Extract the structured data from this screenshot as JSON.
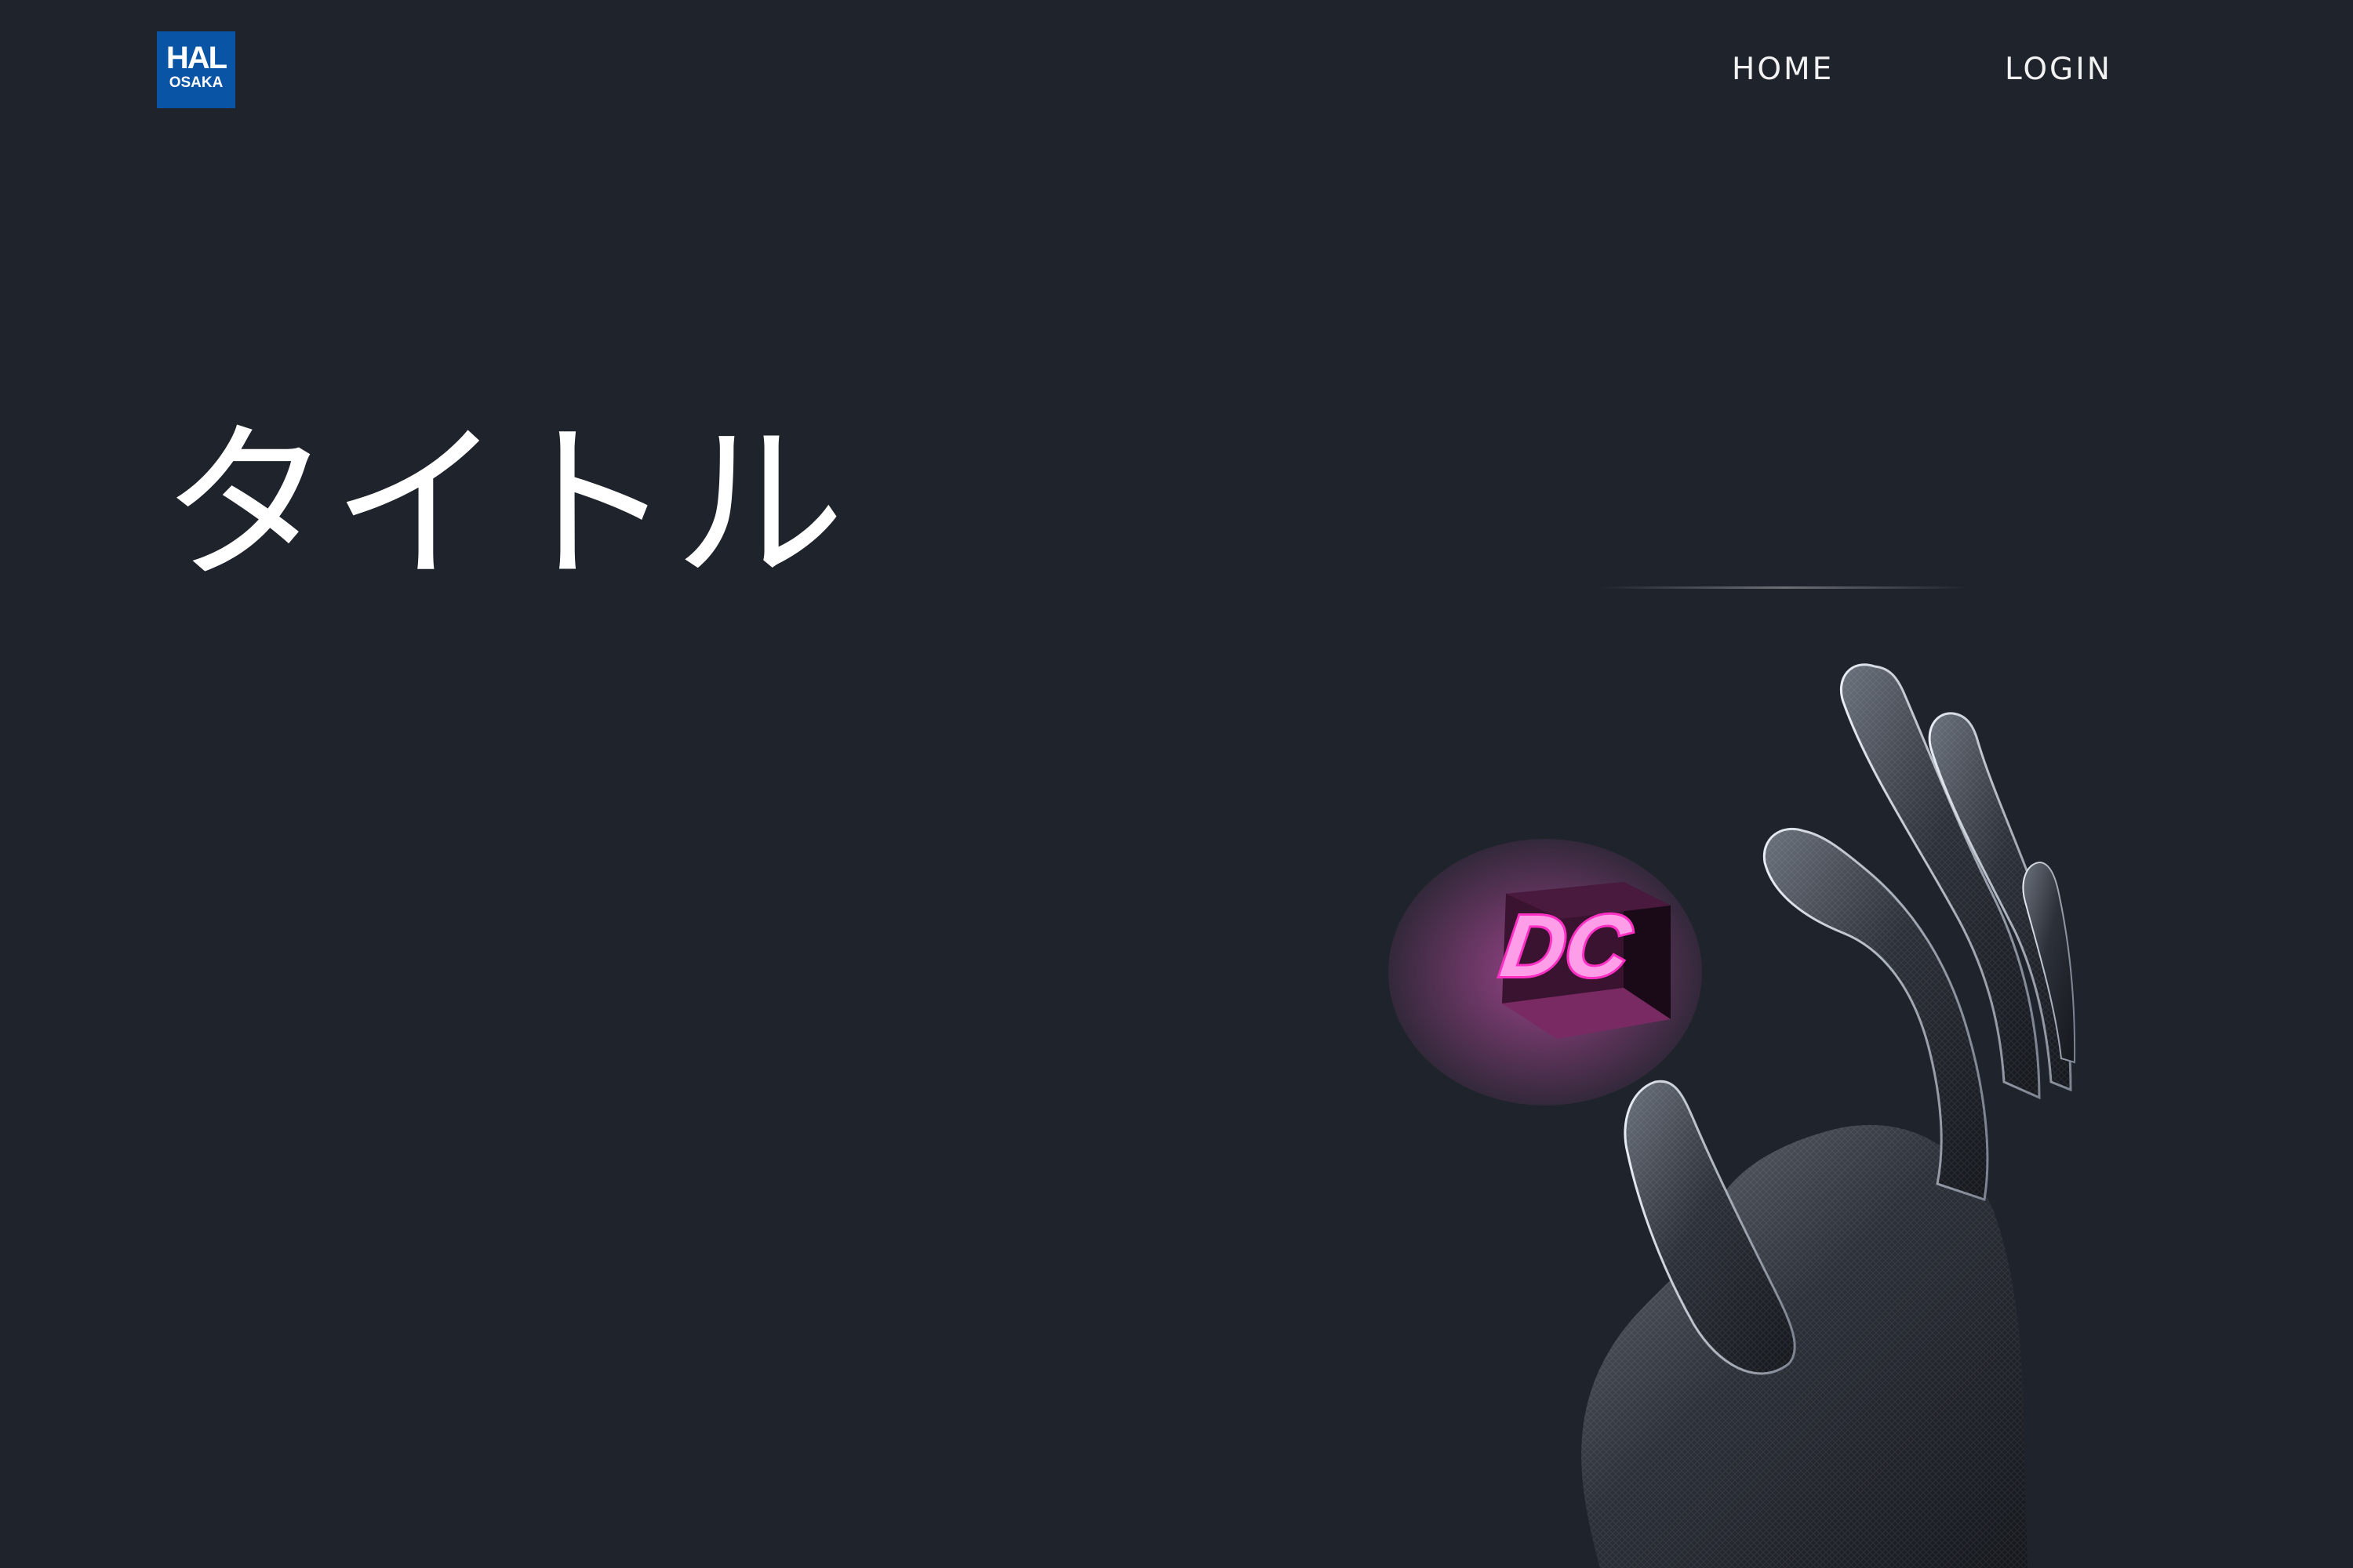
{
  "header": {
    "logo": {
      "main_text": "HAL",
      "sub_text": "OSAKA",
      "color": "#0a54a6"
    },
    "nav": [
      {
        "label": "HOME"
      },
      {
        "label": "LOGIN"
      }
    ]
  },
  "hero": {
    "title": "タイトル",
    "image": {
      "cube_text": "DC",
      "glow_color": "#ff5fd6"
    }
  },
  "colors": {
    "background": "#1f232b",
    "text": "#ffffff"
  }
}
